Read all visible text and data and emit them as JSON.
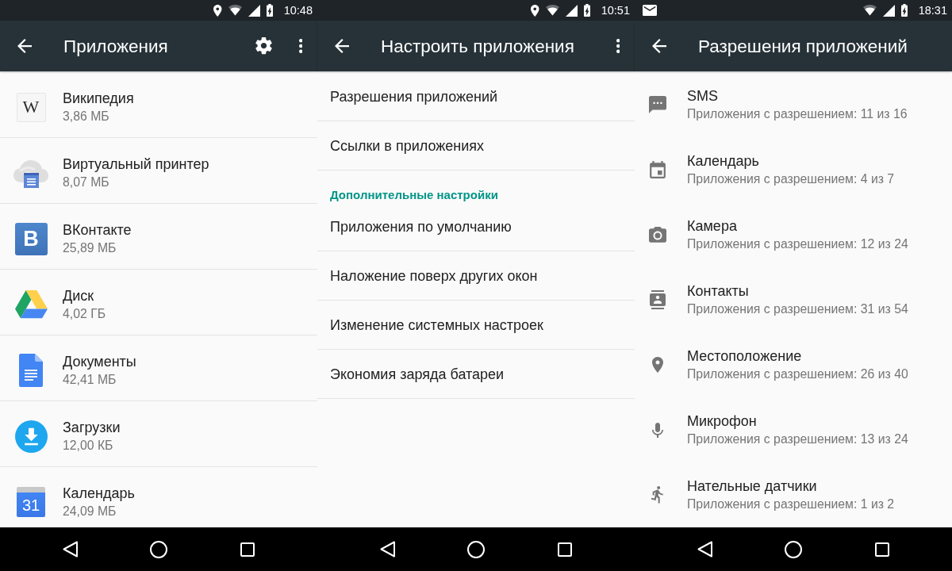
{
  "screens": [
    {
      "status_bar": {
        "status_icons": [
          {
            "kind": "location"
          },
          {
            "kind": "wifi"
          },
          {
            "kind": "signal"
          },
          {
            "kind": "battery_charging"
          }
        ],
        "time": "10:48"
      },
      "app_bar": {
        "title": "Приложения",
        "actions": [
          {
            "kind": "settings"
          },
          {
            "kind": "more"
          }
        ]
      },
      "apps": [
        {
          "kind": "light_letter_tile",
          "icon_text": "W",
          "name": "Википедия",
          "size": "3,86 МБ"
        },
        {
          "kind": "cloud_printer",
          "name": "Виртуальный принтер",
          "size": "8,07 МБ"
        },
        {
          "kind": "blue_letter_tile",
          "icon_text": "В",
          "name": "ВКонтакте",
          "size": "25,89 МБ"
        },
        {
          "kind": "drive_triangle",
          "name": "Диск",
          "size": "4,02 ГБ"
        },
        {
          "kind": "document",
          "name": "Документы",
          "size": "42,41 МБ"
        },
        {
          "kind": "download",
          "name": "Загрузки",
          "size": "12,00 КБ"
        },
        {
          "kind": "calendar_tile",
          "icon_text": "31",
          "name": "Календарь",
          "size": "24,09 МБ"
        }
      ]
    },
    {
      "status_bar": {
        "status_icons": [
          {
            "kind": "location"
          },
          {
            "kind": "wifi"
          },
          {
            "kind": "signal"
          },
          {
            "kind": "battery_charging"
          }
        ],
        "time": "10:51"
      },
      "app_bar": {
        "title": "Настроить приложения",
        "actions": [
          {
            "kind": "more"
          }
        ]
      },
      "settings": [
        {
          "kind": "item",
          "label": "Разрешения приложений"
        },
        {
          "kind": "item",
          "label": "Ссылки в приложениях"
        },
        {
          "kind": "section_header",
          "label": "Дополнительные настройки"
        },
        {
          "kind": "item",
          "label": "Приложения по умолчанию"
        },
        {
          "kind": "item",
          "label": "Наложение поверх других окон"
        },
        {
          "kind": "item",
          "label": "Изменение системных настроек"
        },
        {
          "kind": "item",
          "label": "Экономия заряда батареи"
        }
      ]
    },
    {
      "status_bar": {
        "notification_icons": [
          {
            "kind": "mail"
          }
        ],
        "status_icons": [
          {
            "kind": "wifi"
          },
          {
            "kind": "signal"
          },
          {
            "kind": "battery_charging"
          }
        ],
        "time": "18:31"
      },
      "app_bar": {
        "title": "Разрешения приложений"
      },
      "permissions": [
        {
          "kind": "sms",
          "name": "SMS",
          "summary": "Приложения с разрешением: 11 из 16"
        },
        {
          "kind": "calendar",
          "name": "Календарь",
          "summary": "Приложения с разрешением: 4 из 7"
        },
        {
          "kind": "camera",
          "name": "Камера",
          "summary": "Приложения с разрешением: 12 из 24"
        },
        {
          "kind": "contacts",
          "name": "Контакты",
          "summary": "Приложения с разрешением: 31 из 54"
        },
        {
          "kind": "location",
          "name": "Местоположение",
          "summary": "Приложения с разрешением: 26 из 40"
        },
        {
          "kind": "microphone",
          "name": "Микрофон",
          "summary": "Приложения с разрешением: 13 из 24"
        },
        {
          "kind": "body_sensors",
          "name": "Нательные датчики",
          "summary": "Приложения с разрешением: 1 из 2"
        }
      ]
    }
  ]
}
